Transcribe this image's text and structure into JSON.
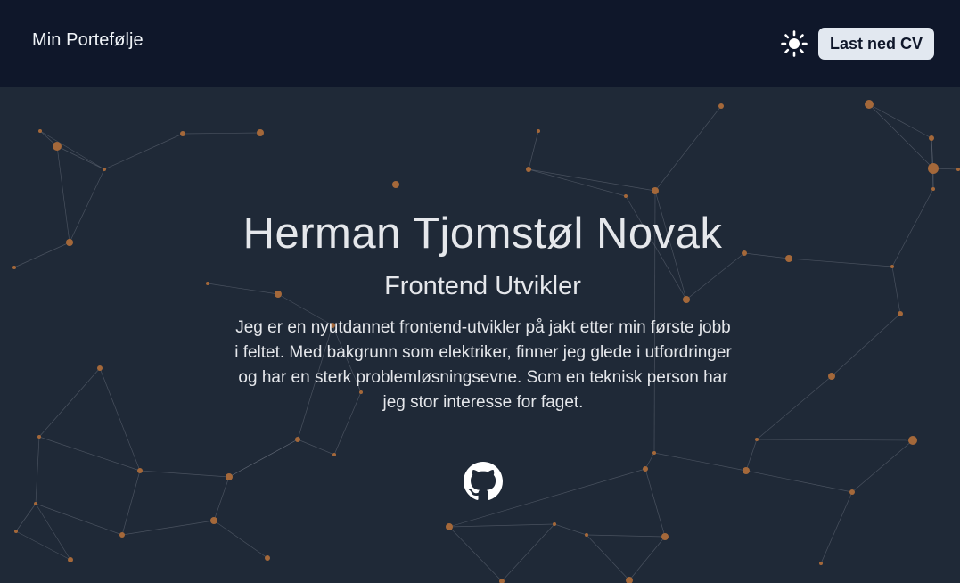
{
  "navbar": {
    "brand": "Min Portefølje",
    "theme_toggle_icon": "sun-icon",
    "cv_button_label": "Last ned CV"
  },
  "hero": {
    "name": "Herman Tjomstøl Novak",
    "role": "Frontend Utvikler",
    "bio": "Jeg er en nyutdannet frontend-utvikler på jakt etter min første jobb i feltet. Med bakgrunn som elektriker, finner jeg glede i utfordringer og har en sterk problemløsningsevne. Som en teknisk person har jeg stor interesse for faget.",
    "social_icon": "github-icon"
  },
  "colors": {
    "navbar_bg": "#0f172a",
    "page_bg": "#1f2937",
    "text": "#e5e7eb",
    "node_color": "#b87333",
    "cv_button_bg": "#e2e8f0"
  }
}
